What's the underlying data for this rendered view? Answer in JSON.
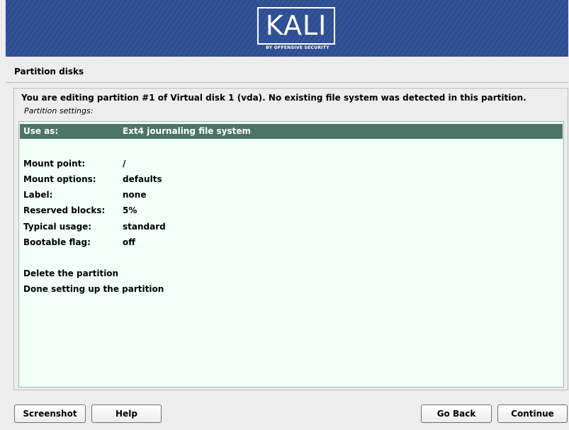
{
  "banner": {
    "logo_text": "KALI",
    "logo_subtitle": "BY OFFENSIVE SECURITY",
    "brand_color": "#2f4f92"
  },
  "page": {
    "title": "Partition disks",
    "description": "You are editing partition #1 of Virtual disk 1 (vda). No existing file system was detected in this partition.",
    "settings_label": "Partition settings:"
  },
  "settings": {
    "selected_color": "#4d7567",
    "use_as": {
      "label": "Use as:",
      "value": "Ext4 journaling file system"
    },
    "mount_point": {
      "label": "Mount point:",
      "value": "/"
    },
    "mount_options": {
      "label": "Mount options:",
      "value": "defaults"
    },
    "label": {
      "label": "Label:",
      "value": "none"
    },
    "reserved_blocks": {
      "label": "Reserved blocks:",
      "value": "5%"
    },
    "typical_usage": {
      "label": "Typical usage:",
      "value": "standard"
    },
    "bootable_flag": {
      "label": "Bootable flag:",
      "value": "off"
    },
    "delete_partition": "Delete the partition",
    "done_setup": "Done setting up the partition"
  },
  "buttons": {
    "screenshot": "Screenshot",
    "help": "Help",
    "go_back": "Go Back",
    "continue": "Continue"
  }
}
